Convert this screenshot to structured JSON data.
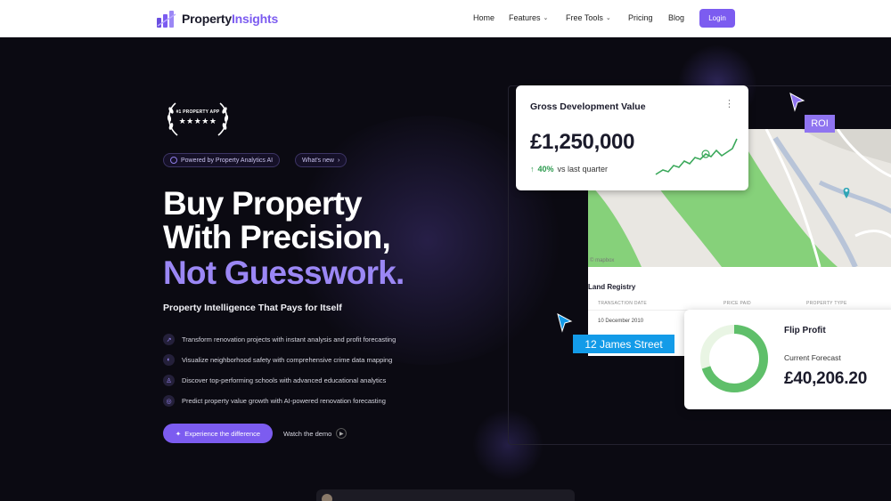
{
  "nav": {
    "brand": "Property",
    "brand_accent": "Insights",
    "links": {
      "home": "Home",
      "features": "Features",
      "free_tools": "Free Tools",
      "pricing": "Pricing",
      "blog": "Blog"
    },
    "login": "Login"
  },
  "hero": {
    "award_text": "#1 PROPERTY APP",
    "award_stars": "★★★★★",
    "badge_powered": "Powered by Property Analytics AI",
    "badge_new": "What's new",
    "headline_1": "Buy Property",
    "headline_2": "With Precision,",
    "headline_3": "Not Guesswork.",
    "subheadline": "Property Intelligence That Pays for Itself",
    "features": [
      "Transform renovation projects with instant analysis and profit forecasting",
      "Visualize neighborhood safety with comprehensive crime data mapping",
      "Discover top-performing schools with advanced educational analytics",
      "Predict property value growth with AI-powered renovation forecasting"
    ],
    "cta": "Experience the difference",
    "demo": "Watch the demo"
  },
  "gdv": {
    "title": "Gross Development Value",
    "value": "£1,250,000",
    "change_pct": "40%",
    "change_label": "vs last quarter"
  },
  "map": {
    "credit": "© mapbox"
  },
  "land_registry": {
    "title": "Land Registry",
    "headers": [
      "TRANSACTION DATE",
      "PRICE PAID",
      "PROPERTY TYPE"
    ],
    "row_date": "10 December 2010"
  },
  "flip": {
    "title": "Flip Profit",
    "subtitle": "Current Forecast",
    "value": "£40,206.20",
    "progress": 0.7
  },
  "tags": {
    "roi": "ROI",
    "address": "12 James Street"
  },
  "colors": {
    "accent": "#7c5cf0",
    "accent_light": "#9b87f5",
    "positive": "#2b9a4d",
    "map_green": "#86d17a",
    "tag_blue": "#139be8"
  }
}
